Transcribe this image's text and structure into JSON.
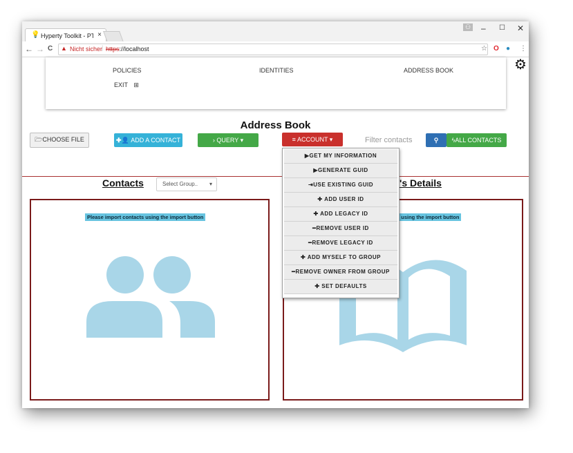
{
  "browser": {
    "tab_title": "Hyperty Toolkit - PTInov",
    "tab_close": "×",
    "window_controls": {
      "user": "⚇",
      "minimize": "–",
      "maximize": "☐",
      "close": "✕"
    },
    "nav": {
      "back": "←",
      "forward": "→",
      "reload": "C"
    },
    "security_label": "Nicht sicher",
    "url_scheme": "https",
    "url_rest": "://localhost",
    "icons": [
      "star-icon",
      "opera-icon",
      "extension-icon",
      "menu-icon"
    ]
  },
  "nav_menu": {
    "policies": "POLICIES",
    "identities": "IDENTITIES",
    "address_book": "ADDRESS BOOK",
    "exit": "EXIT"
  },
  "page_title": "Address Book",
  "toolbar": {
    "choose_file": "CHOOSE FILE",
    "add_contact": "ADD A CONTACT",
    "query": "QUERY",
    "account": "ACCOUNT",
    "filter_placeholder": "Filter contacts",
    "all_contacts": "ALL CONTACTS"
  },
  "account_menu": [
    {
      "icon": "▶",
      "label": "GET MY INFORMATION"
    },
    {
      "icon": "▶",
      "label": "GENERATE GUID"
    },
    {
      "icon": "⇥",
      "label": "USE EXISTING GUID"
    },
    {
      "icon": "✚",
      "label": "ADD USER ID"
    },
    {
      "icon": "✚",
      "label": "ADD LEGACY ID"
    },
    {
      "icon": "━",
      "label": "REMOVE USER ID"
    },
    {
      "icon": "━",
      "label": "REMOVE LEGACY ID"
    },
    {
      "icon": "✚",
      "label": "ADD MYSELF TO GROUP"
    },
    {
      "icon": "━",
      "label": "REMOVE OWNER FROM GROUP"
    },
    {
      "icon": "✚",
      "label": "SET DEFAULTS"
    }
  ],
  "contacts": {
    "heading": "Contacts",
    "group_select": "Select Group..",
    "import_note": "Please import contacts using the import button"
  },
  "details": {
    "heading_visible": "'s Details",
    "import_note_visible": "s using the import button"
  },
  "colors": {
    "primary_blue": "#35b2d8",
    "green": "#44a847",
    "red": "#c9302c",
    "dark_blue": "#2f6fb3",
    "panel_border": "#7a1a1a",
    "placeholder_icon": "#a9d6e8"
  }
}
